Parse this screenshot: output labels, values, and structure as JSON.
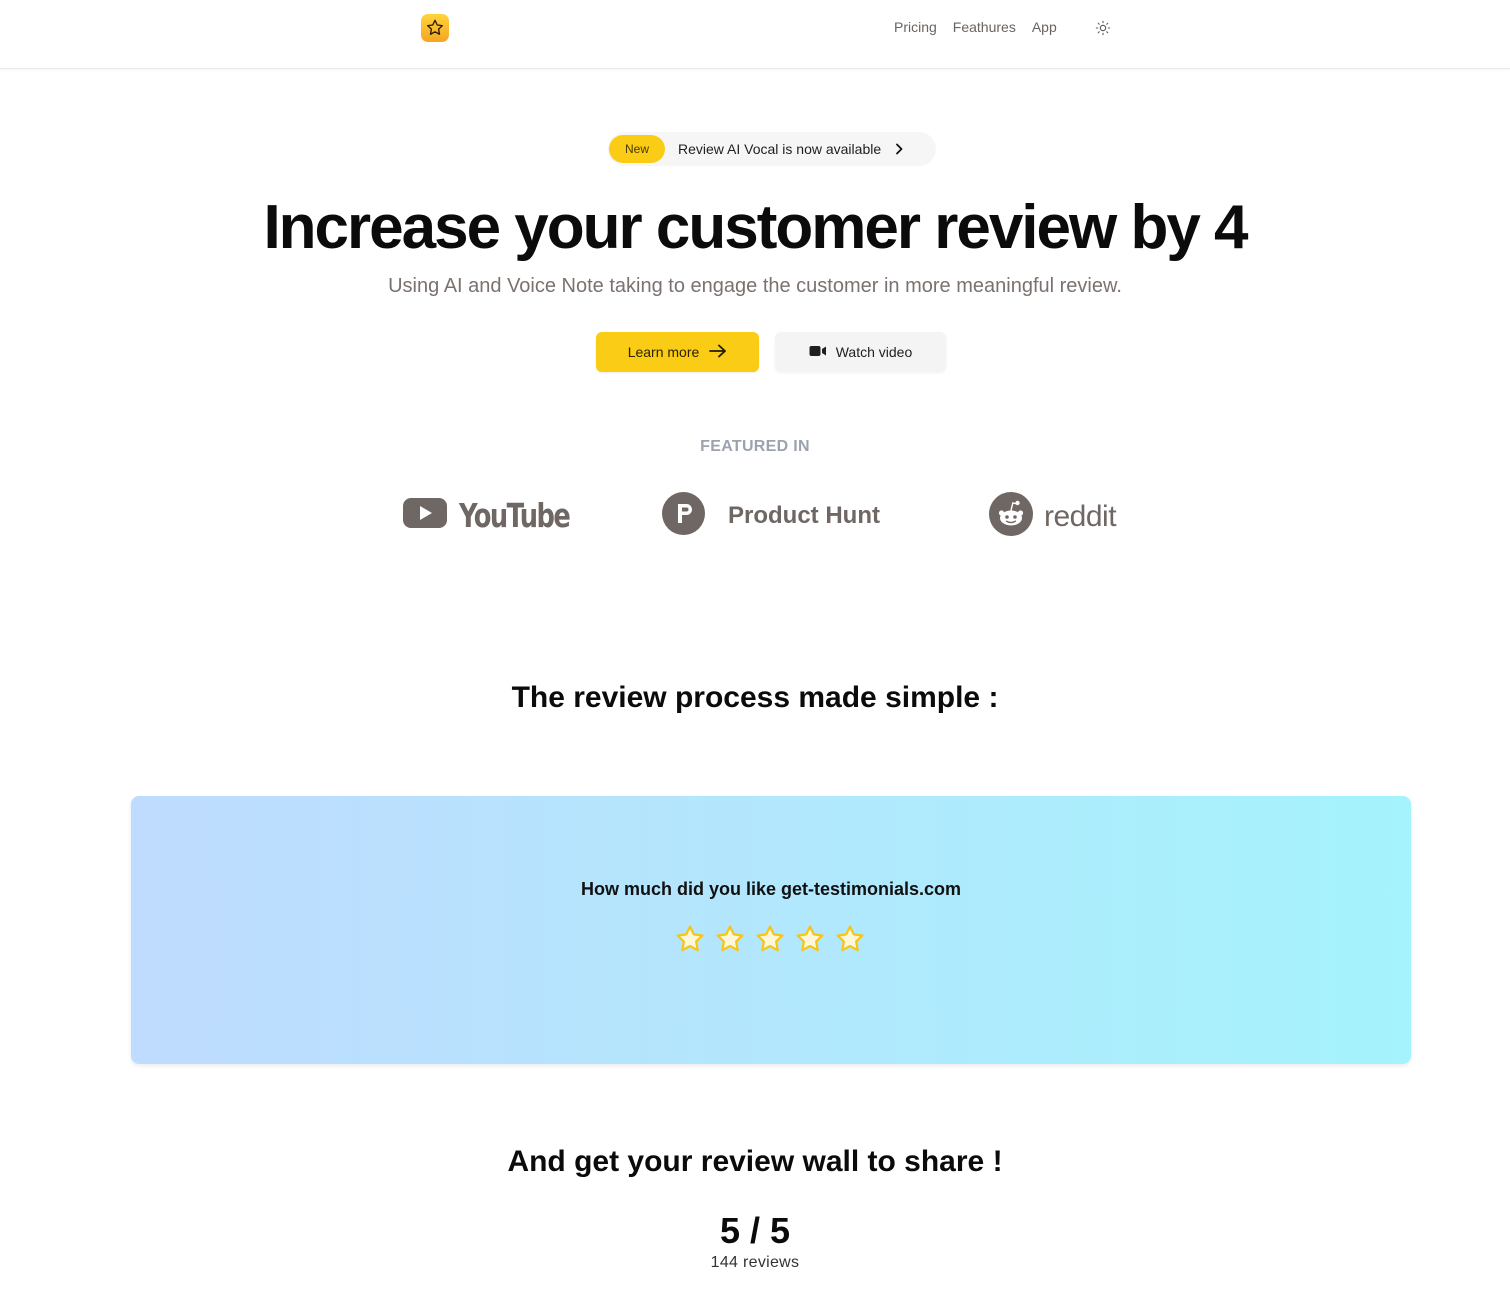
{
  "nav": {
    "links": [
      "Pricing",
      "Feathures",
      "App"
    ]
  },
  "announcement": {
    "badge": "New",
    "text": "Review AI Vocal is now available"
  },
  "hero": {
    "title": "Increase your customer review by 4",
    "subtitle": "Using AI and Voice Note taking to engage the customer in more meaningful review.",
    "primary_button": "Learn more",
    "secondary_button": "Watch video"
  },
  "featured": {
    "label": "FEATURED IN",
    "brands": [
      "YouTube",
      "Product Hunt",
      "reddit"
    ]
  },
  "process": {
    "title": "The review process made simple :",
    "question": "How much did you like get-testimonials.com",
    "star_count": 5
  },
  "wall": {
    "title": "And get your review wall to share !",
    "score": "5 / 5",
    "count": "144 reviews"
  },
  "colors": {
    "accent": "#facc15",
    "card_gradient_start": "#bfdbfe",
    "card_gradient_end": "#a5f3fc",
    "brand_gray": "#6f6763"
  }
}
